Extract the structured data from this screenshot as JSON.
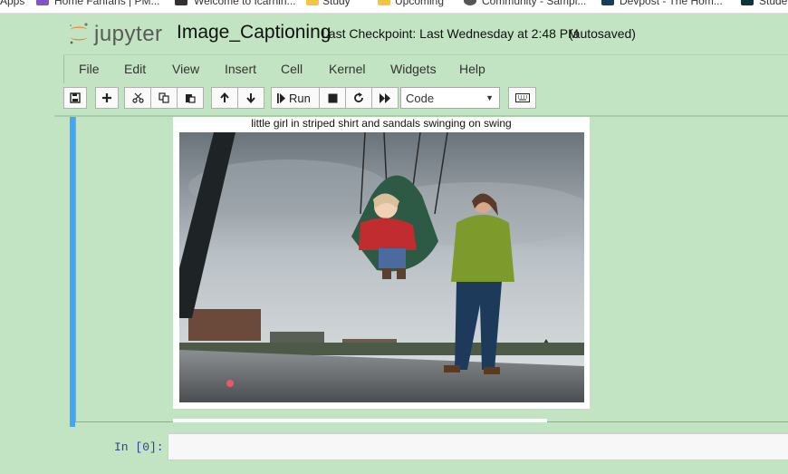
{
  "bookmarks": [
    "Apps",
    "Home Fanfans | PM...",
    "Welcome to Icarnin...",
    "Study",
    "Upcoming",
    "Community - Sampl...",
    "Devpost - The Hom...",
    "Stude..."
  ],
  "logo_text": "jupyter",
  "notebook_name": "Image_Captioning",
  "checkpoint": "Last Checkpoint: Last Wednesday at 2:48 PM",
  "autosave_status": "(autosaved)",
  "menu": [
    "File",
    "Edit",
    "View",
    "Insert",
    "Cell",
    "Kernel",
    "Widgets",
    "Help"
  ],
  "toolbar": {
    "run_label": "Run",
    "cell_type": "Code"
  },
  "output": {
    "caption": "little girl in striped shirt and sandals swinging on swing"
  },
  "next_cell": {
    "prompt": "In [0]:"
  },
  "colors": {
    "background": "#c2e4c2",
    "selected_cell_bar": "#42a5f5",
    "logo_orange": "#f37726"
  }
}
